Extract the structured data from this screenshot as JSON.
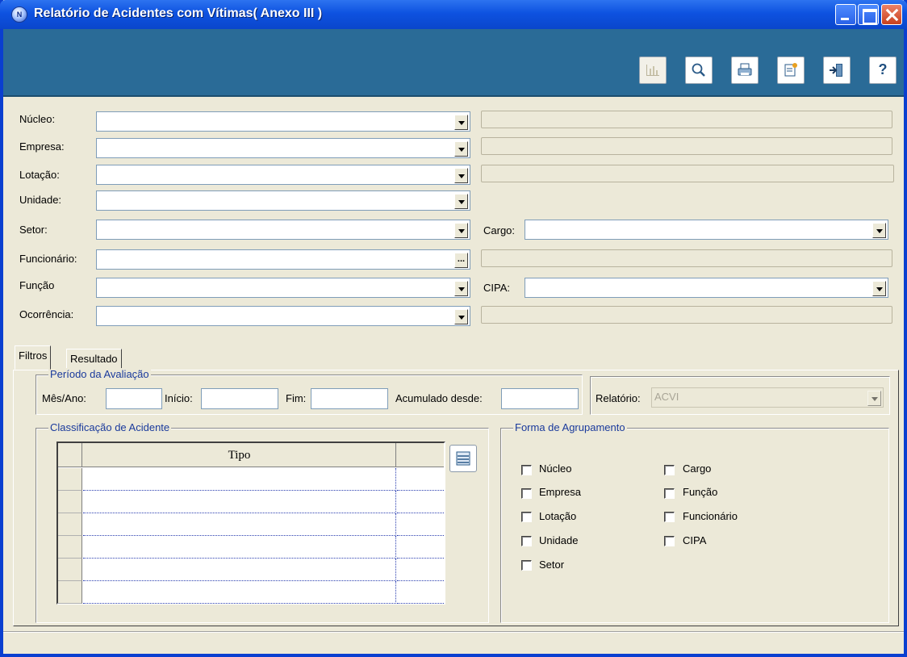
{
  "window": {
    "title": "Relatório de Acidentes com Vítimas( Anexo III )"
  },
  "toolbar": {
    "buttons": [
      {
        "icon": "chart-icon",
        "enabled": false
      },
      {
        "icon": "magnifier-icon",
        "enabled": true
      },
      {
        "icon": "printer-icon",
        "enabled": true
      },
      {
        "icon": "edit-document-icon",
        "enabled": true
      },
      {
        "icon": "exit-door-icon",
        "enabled": true
      },
      {
        "icon": "help-icon",
        "label": "?",
        "enabled": true
      }
    ]
  },
  "form": {
    "nucleo_label": "Núcleo:",
    "empresa_label": "Empresa:",
    "lotacao_label": "Lotação:",
    "unidade_label": "Unidade:",
    "setor_label": "Setor:",
    "cargo_label": "Cargo:",
    "funcionario_label": "Funcionário:",
    "funcionario_button": "...",
    "funcao_label": "Função",
    "cipa_label": "CIPA:",
    "ocorrencia_label": "Ocorrência:"
  },
  "tabs": [
    {
      "label": "Filtros",
      "active": true
    },
    {
      "label": "Resultado",
      "active": false
    }
  ],
  "periodo": {
    "title": "Período da Avaliação",
    "mes_ano_label": "Mês/Ano:",
    "inicio_label": "Início:",
    "fim_label": "Fim:",
    "acumulado_label": "Acumulado desde:"
  },
  "relatorio": {
    "label": "Relatório:",
    "value": "ACVI"
  },
  "classificacao": {
    "title": "Classificação de Acidente",
    "column": "Tipo",
    "row_count": 6
  },
  "agrupamento": {
    "title": "Forma de Agrupamento",
    "left": [
      "Núcleo",
      "Empresa",
      "Lotação",
      "Unidade",
      "Setor"
    ],
    "right": [
      "Cargo",
      "Função",
      "Funcionário",
      "CIPA"
    ]
  }
}
